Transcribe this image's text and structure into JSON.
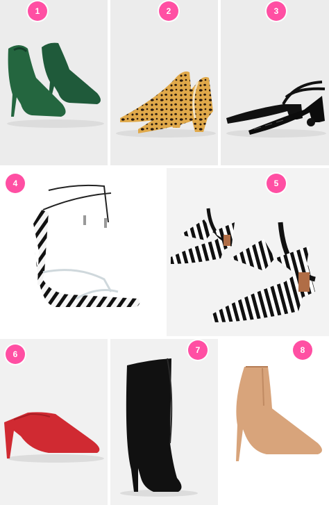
{
  "colors": {
    "badge": "#ff4fa3",
    "tile_background": "#eeeeee",
    "white_tile_background": "#ffffff"
  },
  "items": [
    {
      "number": "1",
      "image": "green-suede-ankle-boot"
    },
    {
      "number": "2",
      "image": "leopard-print-block-heel-pump"
    },
    {
      "number": "3",
      "image": "black-croc-double-strap-mary-jane"
    },
    {
      "number": "4",
      "image": "zebra-clear-strap-tie-up-sandal"
    },
    {
      "number": "5",
      "image": "striped-bow-block-heel-pump"
    },
    {
      "number": "6",
      "image": "red-leather-stiletto-mule"
    },
    {
      "number": "7",
      "image": "black-suede-knee-high-boot"
    },
    {
      "number": "8",
      "image": "tan-suede-pointed-ankle-boot"
    }
  ]
}
